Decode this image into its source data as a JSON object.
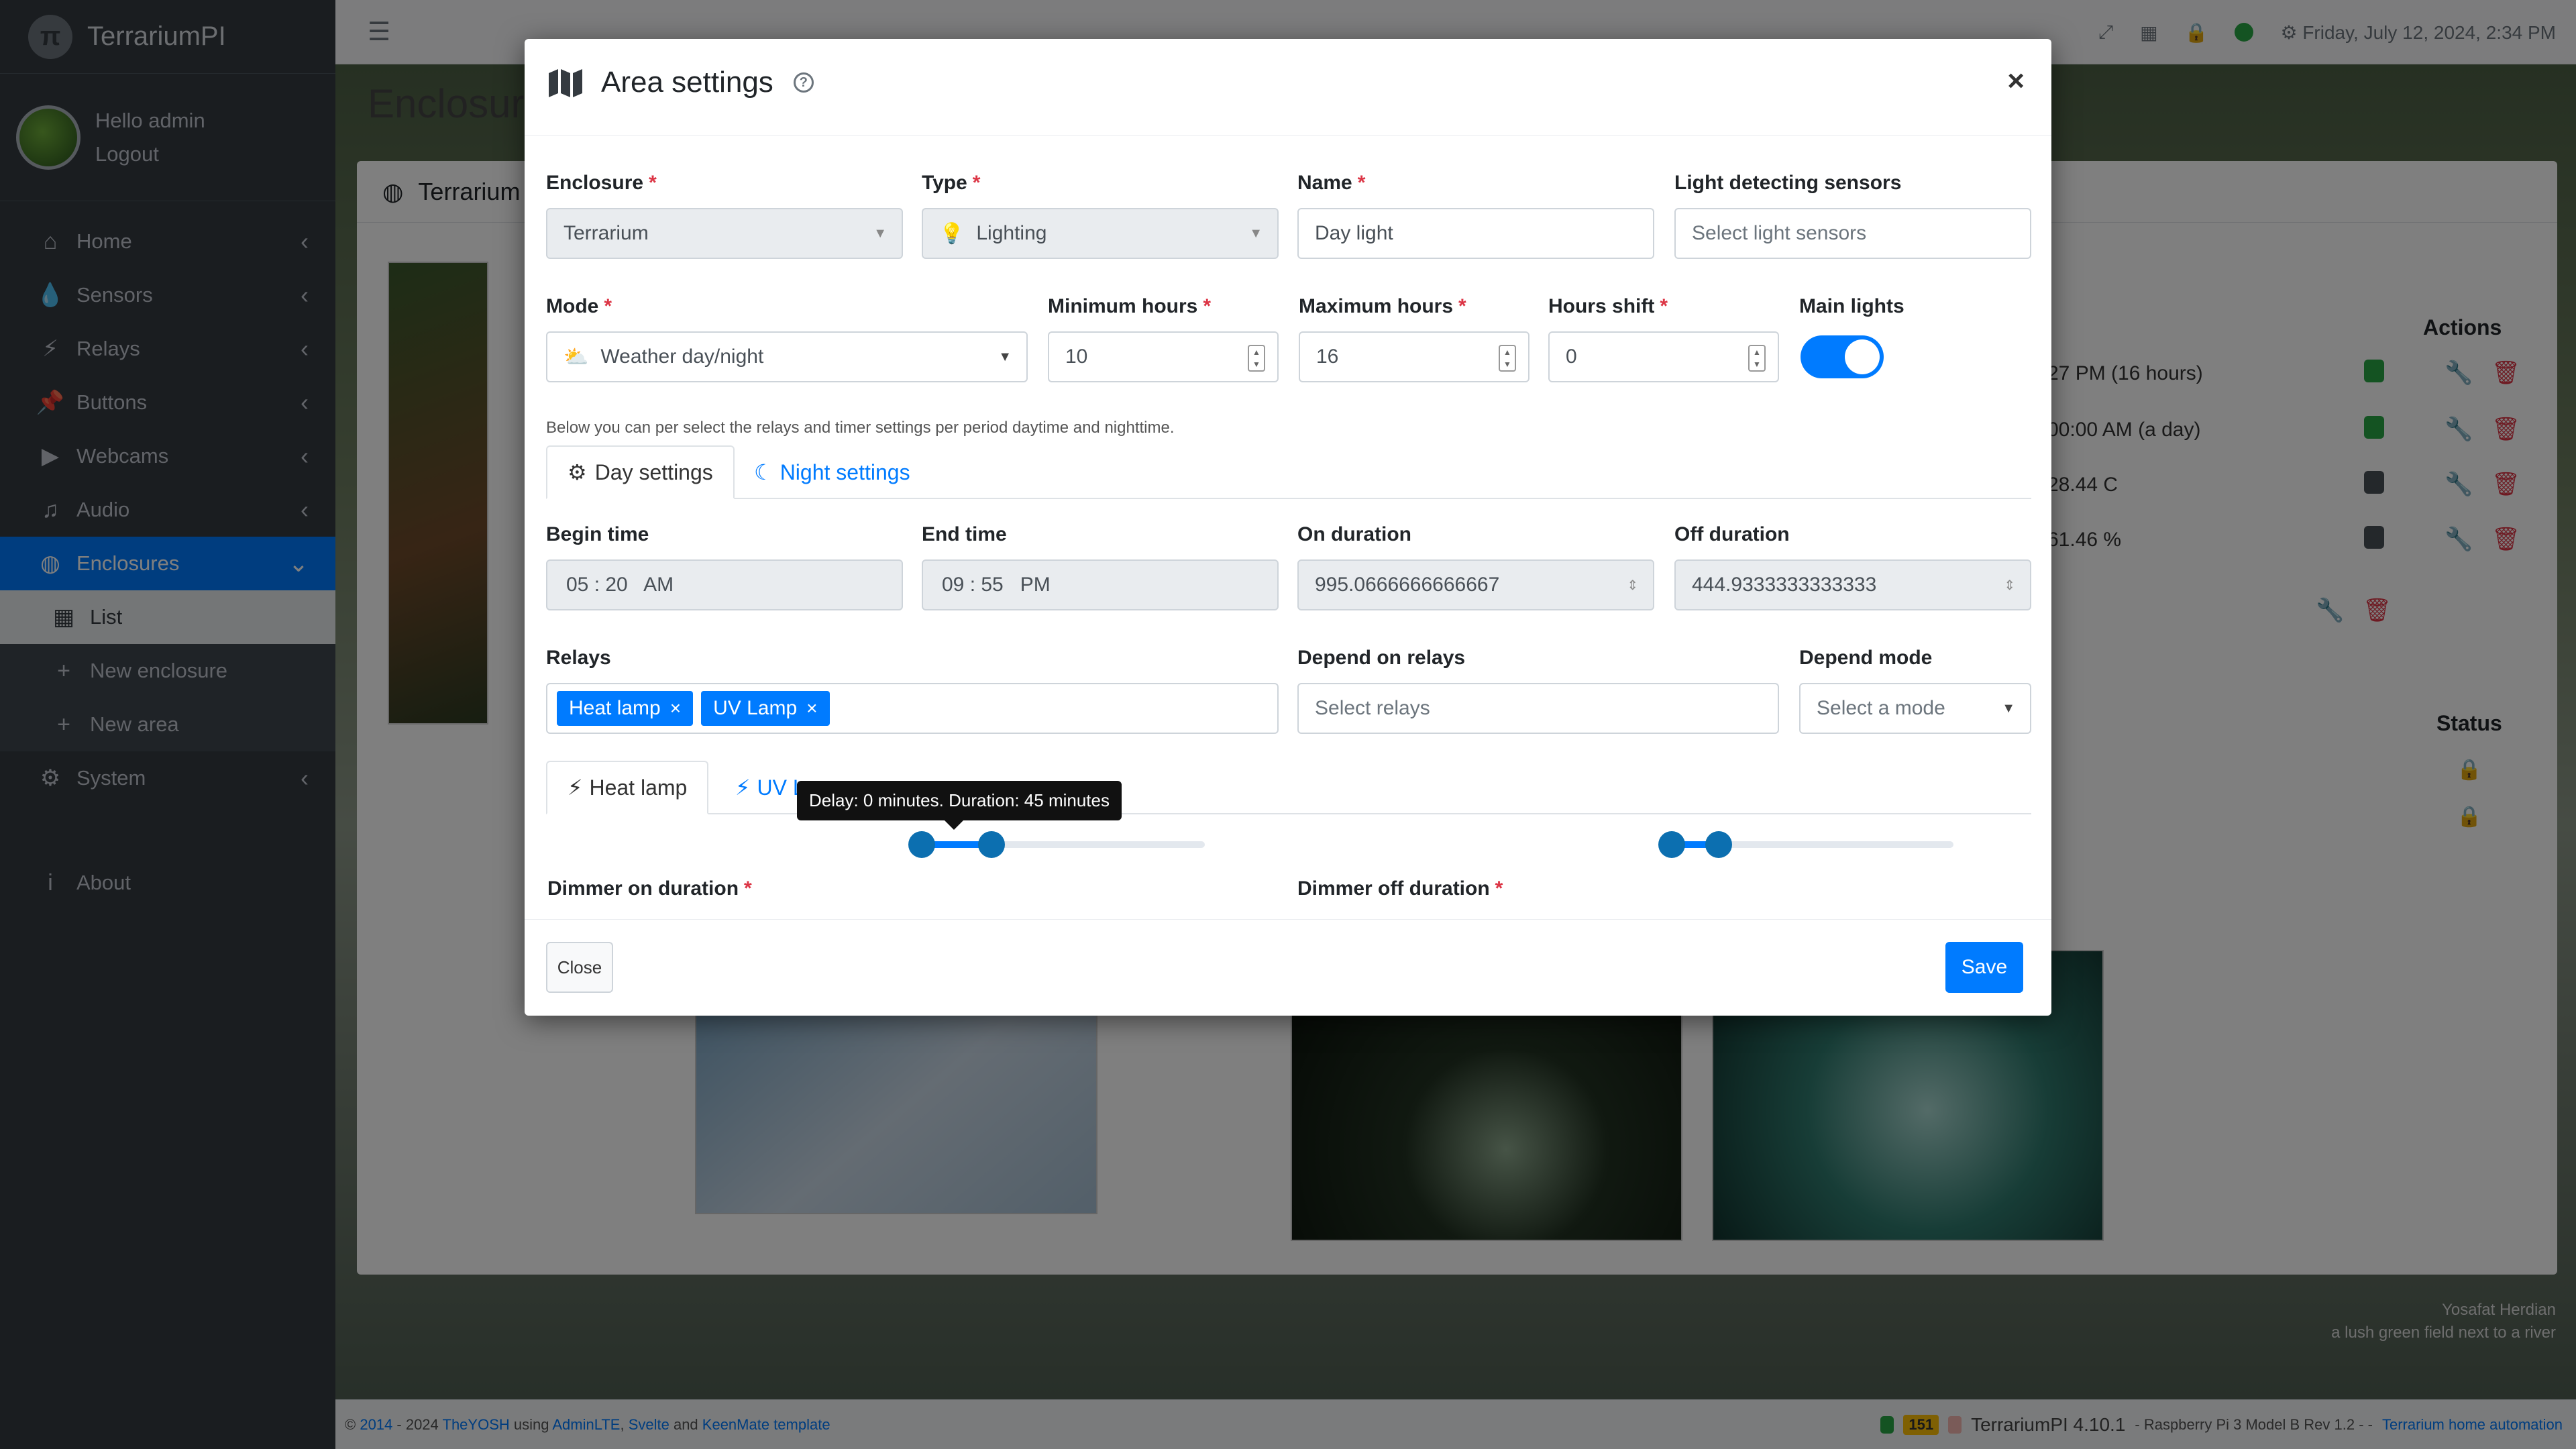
{
  "app": {
    "brand": "TerrariumPI"
  },
  "user": {
    "greeting": "Hello admin",
    "logout": "Logout"
  },
  "sidebar": {
    "items": [
      {
        "label": "Home",
        "icon": "home-icon",
        "glyph": "⌂"
      },
      {
        "label": "Sensors",
        "icon": "droplet-icon",
        "glyph": "💧"
      },
      {
        "label": "Relays",
        "icon": "bolt-icon",
        "glyph": "⚡"
      },
      {
        "label": "Buttons",
        "icon": "pushpin-icon",
        "glyph": "📌"
      },
      {
        "label": "Webcams",
        "icon": "video-icon",
        "glyph": "▶"
      },
      {
        "label": "Audio",
        "icon": "music-icon",
        "glyph": "♫"
      },
      {
        "label": "Enclosures",
        "icon": "globe-icon",
        "glyph": "◍"
      }
    ],
    "sub_items": [
      {
        "label": "List",
        "icon": "building-icon",
        "glyph": "▦"
      },
      {
        "label": "New enclosure",
        "icon": "plus-icon",
        "glyph": "+"
      },
      {
        "label": "New area",
        "icon": "plus-icon",
        "glyph": "+"
      }
    ],
    "system": "System",
    "about": "About"
  },
  "topbar": {
    "datetime": "Friday, July 12, 2024, 2:34 PM"
  },
  "background": {
    "page_title": "Enclosure",
    "card_title": "Terrarium",
    "actions_header": "Actions",
    "status_header": "Status",
    "rows": [
      "27 PM (16 hours)",
      "00:00 AM (a day)",
      "28.44 C",
      "61.46 %"
    ],
    "row_colors": [
      "#28a745",
      "#28a745",
      "#495057",
      "#495057"
    ]
  },
  "modal": {
    "title": "Area settings",
    "close_symbol": "×",
    "labels": {
      "enclosure": "Enclosure",
      "type": "Type",
      "name": "Name",
      "light_sensors": "Light detecting sensors",
      "mode": "Mode",
      "min_hours": "Minimum hours",
      "max_hours": "Maximum hours",
      "hours_shift": "Hours shift",
      "main_lights": "Main lights",
      "begin_time": "Begin time",
      "end_time": "End time",
      "on_duration": "On duration",
      "off_duration": "Off duration",
      "relays": "Relays",
      "depend_relays": "Depend on relays",
      "depend_mode": "Depend mode",
      "dimmer_on": "Dimmer on duration",
      "dimmer_off": "Dimmer off duration"
    },
    "values": {
      "enclosure": "Terrarium",
      "type": "Lighting",
      "name": "Day light",
      "mode": "Weather day/night",
      "min_hours": "10",
      "max_hours": "16",
      "hours_shift": "0",
      "begin_time": "05 : 20   AM",
      "end_time": "09 : 55   PM",
      "on_duration": "995.0666666666667",
      "off_duration": "444.9333333333333",
      "main_lights_on": true
    },
    "placeholders": {
      "light_sensors": "Select light sensors",
      "depend_relays": "Select relays",
      "depend_mode": "Select a mode"
    },
    "hint": "Below you can per select the relays and timer settings per period daytime and nighttime.",
    "period_tabs": {
      "day": "Day settings",
      "night": "Night settings"
    },
    "relay_chips": [
      "Heat lamp",
      "UV Lamp"
    ],
    "relay_tabs": {
      "first": "Heat lamp",
      "second": "UV L"
    },
    "tooltip": "Delay: 0 minutes. Duration: 45 minutes",
    "buttons": {
      "close": "Close",
      "save": "Save"
    }
  },
  "footer": {
    "copyright_prefix": "© ",
    "year_start": "2014",
    "year_rest": " - 2024 ",
    "author": "TheYOSH",
    "using": " using ",
    "admin": "AdminLTE",
    "sep1": ", ",
    "svelte": "Svelte",
    "and": " and ",
    "template": "KeenMate template",
    "badge_count": "151",
    "version": "TerrariumPI 4.10.1",
    "hardware": " - Raspberry Pi 3 Model B Rev 1.2 - - ",
    "tagline": "Terrarium home automation"
  },
  "credit": {
    "author": "Yosafat Herdian",
    "caption": "a lush green field next to a river"
  }
}
